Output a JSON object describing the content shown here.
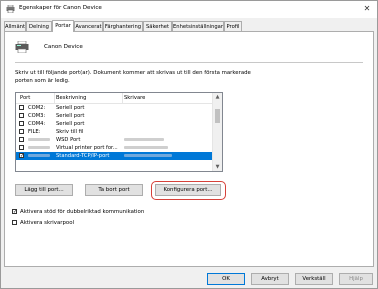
{
  "window": {
    "title": "Egenskaper för Canon Device",
    "close_glyph": "✕"
  },
  "tabs": [
    {
      "label": "Allmänt",
      "active": false
    },
    {
      "label": "Delning",
      "active": false
    },
    {
      "label": "Portar",
      "active": true
    },
    {
      "label": "Avancerat",
      "active": false
    },
    {
      "label": "Färghantering",
      "active": false
    },
    {
      "label": "Säkerhet",
      "active": false
    },
    {
      "label": "Enhetsinställningar",
      "active": false
    },
    {
      "label": "Profil",
      "active": false
    }
  ],
  "printer": {
    "name": "Canon Device"
  },
  "instructions": "Skriv ut till följande port(ar). Dokument kommer att skrivas ut till den första markerade porten som är ledig.",
  "ports_list": {
    "headers": {
      "port": "Port",
      "description": "Beskrivning",
      "printer": "Skrivare"
    },
    "rows": [
      {
        "port": "COM2:",
        "description": "Seriell port",
        "checked": false,
        "selected": false
      },
      {
        "port": "COM3:",
        "description": "Seriell port",
        "checked": false,
        "selected": false
      },
      {
        "port": "COM4:",
        "description": "Seriell port",
        "checked": false,
        "selected": false
      },
      {
        "port": "FILE:",
        "description": "Skriv till fil",
        "checked": false,
        "selected": false
      },
      {
        "port": "",
        "description": "WSD Port",
        "checked": false,
        "selected": false
      },
      {
        "port": "",
        "description": "Virtual printer port for...",
        "checked": false,
        "selected": false
      },
      {
        "port": "",
        "description": "Standard-TCP/IP-port",
        "checked": true,
        "selected": true
      }
    ]
  },
  "buttons": {
    "add_port": "Lägg till port...",
    "delete_port": "Ta bort port",
    "configure_port": "Konfigurera port..."
  },
  "options": {
    "bidirectional": {
      "label": "Aktivera stöd för dubbelriktad kommunikation",
      "checked": true
    },
    "pooling": {
      "label": "Aktivera skrivarpool",
      "checked": false
    }
  },
  "footer": {
    "ok": "OK",
    "cancel": "Avbryt",
    "apply": "Verkställ",
    "help": "Hjälp"
  },
  "colors": {
    "selection": "#0078d7",
    "highlight": "#d6413a"
  }
}
